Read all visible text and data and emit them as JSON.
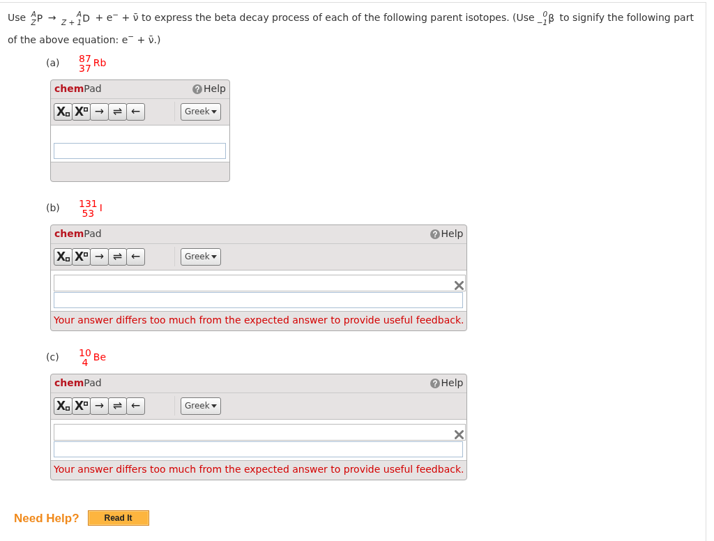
{
  "question": {
    "segments": [
      {
        "kind": "text",
        "text": "Use "
      },
      {
        "kind": "nuclide",
        "mass": "A",
        "number": "Z",
        "symbol": "P"
      },
      {
        "kind": "text",
        "text": " → "
      },
      {
        "kind": "nuclide",
        "mass": "A",
        "number": "Z + 1",
        "symbol": "D"
      },
      {
        "kind": "text",
        "text": " + e$^{−}$ + ν̄ to express the beta decay process of each of the following parent isotopes. (Use"
      },
      {
        "kind": "nuclide",
        "mass": "0",
        "number": "−1",
        "symbol": "β"
      },
      {
        "kind": "text",
        "text": " to signify the following part of the above equation: e$^{−}$ + ν̄.)"
      }
    ]
  },
  "parts": [
    {
      "label": "(a)",
      "isotope": {
        "mass": "87",
        "number": "37",
        "symbol": "Rb"
      },
      "pad": {
        "title": "**chem**Pad",
        "help": "Help",
        "tools": [
          {
            "kind": "subscript",
            "label": "X"
          },
          {
            "kind": "superscript",
            "label": "X"
          },
          {
            "kind": "symbol",
            "label": "→"
          },
          {
            "kind": "symbol",
            "label": "⇌"
          },
          {
            "kind": "symbol",
            "label": "←"
          }
        ],
        "greek": "Greek",
        "incorrect": false
      }
    },
    {
      "label": "(b)",
      "isotope": {
        "mass": "131",
        "number": "53",
        "symbol": "I"
      },
      "pad": {
        "title": "**chem**Pad",
        "help": "Help",
        "tools": [
          {
            "kind": "subscript",
            "label": "X"
          },
          {
            "kind": "superscript",
            "label": "X"
          },
          {
            "kind": "symbol",
            "label": "→"
          },
          {
            "kind": "symbol",
            "label": "⇌"
          },
          {
            "kind": "symbol",
            "label": "←"
          }
        ],
        "greek": "Greek",
        "incorrect": true,
        "feedback": "Your answer differs too much from the expected answer to provide useful feedback."
      }
    },
    {
      "label": "(c)",
      "isotope": {
        "mass": "10",
        "number": "4",
        "symbol": "Be"
      },
      "pad": {
        "title": "**chem**Pad",
        "help": "Help",
        "tools": [
          {
            "kind": "subscript",
            "label": "X"
          },
          {
            "kind": "superscript",
            "label": "X"
          },
          {
            "kind": "symbol",
            "label": "→"
          },
          {
            "kind": "symbol",
            "label": "⇌"
          },
          {
            "kind": "symbol",
            "label": "←"
          }
        ],
        "greek": "Greek",
        "incorrect": true,
        "feedback": "Your answer differs too much from the expected answer to provide useful feedback."
      }
    }
  ],
  "help": {
    "label": "Need Help?",
    "button": "Read It"
  }
}
